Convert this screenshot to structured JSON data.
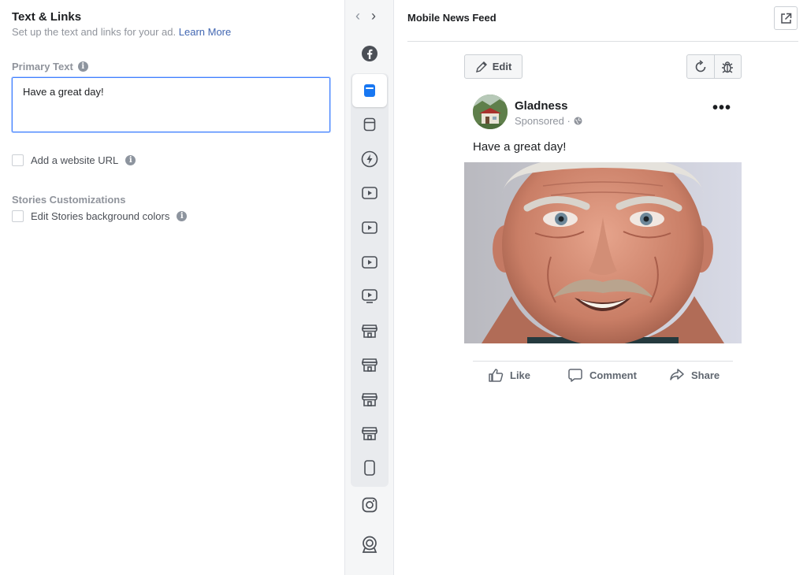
{
  "left_panel": {
    "title": "Text & Links",
    "subtitle": "Set up the text and links for your ad.",
    "learn_more": "Learn More",
    "primary_text_label": "Primary Text",
    "primary_text_value": "Have a great day!",
    "add_url_label": "Add a website URL",
    "stories_title": "Stories Customizations",
    "stories_bg_label": "Edit Stories background colors"
  },
  "placement_strip": {
    "icons": [
      "facebook-icon",
      "feed-icon",
      "feed-outline-icon",
      "lightning-icon",
      "video-icon",
      "video-icon",
      "video-icon",
      "video-screen-icon",
      "marketplace-icon",
      "marketplace-icon",
      "marketplace-icon",
      "marketplace-icon",
      "phone-icon",
      "instagram-icon",
      "messenger-icon"
    ],
    "active_index": 1
  },
  "preview": {
    "title": "Mobile News Feed",
    "edit_label": "Edit",
    "page_name": "Gladness",
    "sponsored": "Sponsored ·",
    "post_text": "Have a great day!",
    "like_label": "Like",
    "comment_label": "Comment",
    "share_label": "Share"
  },
  "colors": {
    "link": "#4267b2",
    "focus_border": "#4080ff",
    "active_icon": "#1877f2",
    "strip_bg": "#f5f6f7"
  }
}
